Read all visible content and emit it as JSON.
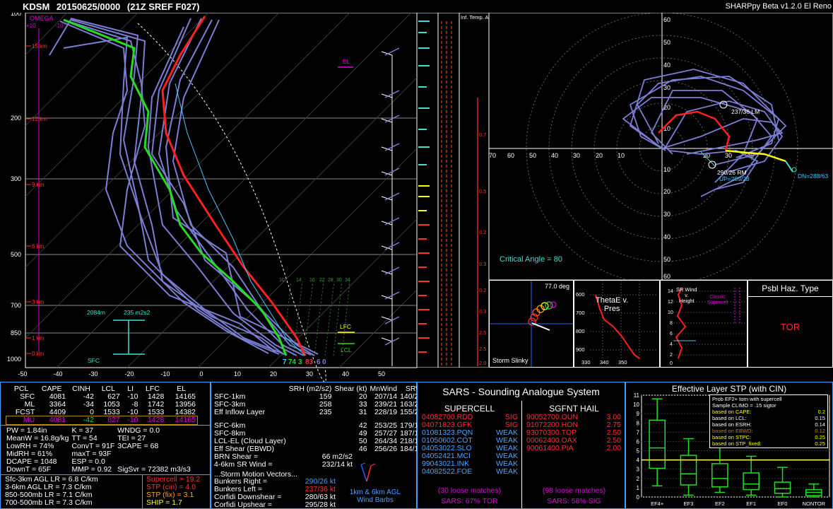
{
  "header": {
    "station": "KDSM",
    "datetime": "20150625/0000",
    "model_info": "(21Z  SREF  F027)",
    "app_name": "SHARPpy Beta v1.2.0 El Reno"
  },
  "skewt": {
    "pressure_labels": [
      "100",
      "200",
      "300",
      "500",
      "700",
      "850",
      "1000"
    ],
    "temp_labels": [
      "-50",
      "-40",
      "-30",
      "-20",
      "-10",
      "0",
      "10",
      "20",
      "30",
      "40",
      "50"
    ],
    "height_labels": [
      "15 km",
      "12 km",
      "9 km",
      "6 km",
      "3 km",
      "1 km",
      "0 km"
    ],
    "omega_label": "OMEGA",
    "omega_ticks": [
      "+10",
      "-10"
    ],
    "el_label": "EL",
    "lfc_label": "LFC",
    "lcl_label": "LCL",
    "sfc_label": "SFC",
    "inflow_top": "2084m",
    "inflow_srh": "235 m2s2",
    "sfc_temp": "83",
    "sfc_dwpt": "74",
    "sfc_wetbulb": "7",
    "sfc_extra": "3",
    "sfc_right1": "6",
    "sfc_right2": "0",
    "mixing_ratio_labels": [
      "10",
      "14",
      "16",
      "22",
      "28",
      "30",
      "34"
    ]
  },
  "inferred_temp": {
    "title": "Inf. Temp. Adv. (C/hr)",
    "values": [
      "0.7",
      "0.5",
      "0.2",
      "0.3",
      "0.2",
      "0.3",
      "2.5",
      "2.5",
      "2.0"
    ]
  },
  "hodograph": {
    "y_labels": [
      "60",
      "50",
      "40",
      "30",
      "20",
      "10",
      "10",
      "20",
      "30",
      "40",
      "50",
      "60"
    ],
    "x_labels": [
      "70",
      "60",
      "50",
      "40",
      "30",
      "20",
      "10",
      "20",
      "30",
      "40"
    ],
    "lm_label": "237/36 LM",
    "rm_label": "290/26 RM",
    "up_label": "UP=209/28",
    "dn_label": "DN=288/63",
    "critical_angle": "Critical Angle = 80"
  },
  "storm_slinky": {
    "title": "Storm Slinky",
    "angle": "77.0 deg"
  },
  "thetae": {
    "title_line1": "ThetaE v.",
    "title_line2": "Pres",
    "y_labels": [
      "600",
      "700",
      "800",
      "900"
    ],
    "x_labels": [
      "330",
      "340",
      "350"
    ]
  },
  "srwind": {
    "title_line1": "SR Wind",
    "title_line2": "v.",
    "title_line3": "Height",
    "classic_line1": "Classic",
    "classic_line2": "Supercell",
    "y_labels": [
      "14",
      "12",
      "10",
      "8",
      "6",
      "4",
      "2",
      "0"
    ]
  },
  "hazard": {
    "title": "Psbl Haz. Type",
    "value": "TOR"
  },
  "thermo": {
    "headers": [
      "PCL",
      "CAPE",
      "CINH",
      "LCL",
      "LI",
      "LFC",
      "EL"
    ],
    "rows": [
      [
        "SFC",
        "4081",
        "-42",
        "627",
        "-10",
        "1428",
        "14165"
      ],
      [
        "ML",
        "3364",
        "-34",
        "1053",
        "-8",
        "1742",
        "13956"
      ],
      [
        "FCST",
        "4409",
        "0",
        "1533",
        "-10",
        "1533",
        "14382"
      ],
      [
        "MU",
        "4081",
        "-42",
        "627",
        "-10",
        "1428",
        "14165"
      ]
    ],
    "indices": [
      [
        "PW = 1.84in",
        "K = 37",
        "WNDG = 0.0"
      ],
      [
        "MeanW = 16.8g/kg",
        "TT = 54",
        "TEI = 27"
      ],
      [
        "LowRH = 74%",
        "ConvT = 91F",
        "3CAPE = 68"
      ],
      [
        "MidRH = 61%",
        "maxT = 93F",
        ""
      ],
      [
        "DCAPE = 1048",
        "ESP = 0.0",
        ""
      ],
      [
        "DownT = 65F",
        "MMP = 0.92",
        "SigSvr = 72382 m3/s3"
      ]
    ],
    "lapse_rates": [
      "Sfc-3km AGL LR = 6.8 C/km",
      "3-6km AGL LR = 7.3 C/km",
      "850-500mb LR = 7.1 C/km",
      "700-500mb LR = 7.3 C/km"
    ],
    "composites": [
      {
        "label": "Supercell = 19.2",
        "color": "#ff3030"
      },
      {
        "label": "STP (cin) = 4.0",
        "color": "#ff3030"
      },
      {
        "label": "STP (fix) = 3.1",
        "color": "#ffa500"
      },
      {
        "label": "SHIP = 1.7",
        "color": "#ffff00"
      }
    ]
  },
  "kinematics": {
    "headers": [
      "SRH (m2/s2)",
      "Shear (kt)",
      "MnWind",
      "SRW"
    ],
    "rows": [
      [
        "SFC-1km",
        "159",
        "20",
        "207/14",
        "140/28"
      ],
      [
        "SFC-3km",
        "258",
        "33",
        "239/21",
        "163/21"
      ],
      [
        "Eff Inflow Layer",
        "235",
        "31",
        "228/19",
        "155/24"
      ],
      [
        "",
        "",
        "",
        "",
        ""
      ],
      [
        "SFC-6km",
        "",
        "42",
        "253/25",
        "179/16"
      ],
      [
        "SFC-8km",
        "",
        "49",
        "257/27",
        "187/15"
      ],
      [
        "LCL-EL (Cloud Layer)",
        "",
        "50",
        "264/34",
        "218/15"
      ],
      [
        "Eff Shear (EBWD)",
        "",
        "46",
        "256/26",
        "184/15"
      ]
    ],
    "brn": [
      [
        "BRN Shear =",
        "66 m2/s2"
      ],
      [
        "4-6km SR Wind =",
        "232/14 kt"
      ]
    ],
    "motion_title": "...Storm Motion Vectors...",
    "motions": [
      {
        "label": "Bunkers Right =",
        "value": "290/26 kt",
        "color": "#4d9dff"
      },
      {
        "label": "Bunkers Left =",
        "value": "237/36 kt",
        "color": "#ff3030"
      },
      {
        "label": "Corfidi Downshear =",
        "value": "280/63 kt",
        "color": "#ffffff"
      },
      {
        "label": "Corfidi Upshear =",
        "value": "295/28 kt",
        "color": "#ffffff"
      }
    ],
    "barb_label_line1": "1km & 6km AGL",
    "barb_label_line2": "Wind Barbs"
  },
  "sars": {
    "title": "SARS - Sounding Analogue System",
    "supercell_title": "SUPERCELL",
    "hail_title": "SGFNT HAIL",
    "supercell": [
      {
        "id": "04082700.RDD",
        "type": "SIG",
        "color": "#ff3030"
      },
      {
        "id": "04071823.GFK",
        "type": "SIG",
        "color": "#ff3030"
      },
      {
        "id": "01081323.PQN",
        "type": "WEAK",
        "color": "#4da6ff"
      },
      {
        "id": "01050602.COT",
        "type": "WEAK",
        "color": "#4da6ff"
      },
      {
        "id": "04053022.SLO",
        "type": "WEAK",
        "color": "#4da6ff"
      },
      {
        "id": "04052421.MCI",
        "type": "WEAK",
        "color": "#4da6ff"
      },
      {
        "id": "99043021.INK",
        "type": "WEAK",
        "color": "#4da6ff"
      },
      {
        "id": "04082522.FOE",
        "type": "WEAK",
        "color": "#4da6ff"
      }
    ],
    "hail": [
      {
        "id": "90052700.OUN",
        "size": "3.00"
      },
      {
        "id": "91072200.HON",
        "size": "2.75"
      },
      {
        "id": "93070300.TOP",
        "size": "2.50"
      },
      {
        "id": "00062400.OAX",
        "size": "2.50"
      },
      {
        "id": "90061400.PIA",
        "size": "2.00"
      }
    ],
    "supercell_matches": "(30 loose matches)",
    "supercell_prob": "SARS: 67% TOR",
    "hail_matches": "(98 loose matches)",
    "hail_prob": "SARS: 58% SIG"
  },
  "stp_box": {
    "title": "Effective Layer STP (with CIN)",
    "legend_title_line1": "Prob EF2+ torn with supercell",
    "legend_title_line2": "Sample CLIMO = .15 sigtor",
    "legend": [
      {
        "label": "based on CAPE:",
        "value": "0.2",
        "color": "#ffff00"
      },
      {
        "label": "based on LCL:",
        "value": "0.15",
        "color": "#ffffff"
      },
      {
        "label": "based on ESRH:",
        "value": "0.14",
        "color": "#ffffff"
      },
      {
        "label": "based on EBWD:",
        "value": "0.12",
        "color": "#b8860b"
      },
      {
        "label": "based on STPC:",
        "value": "0.25",
        "color": "#ffff00"
      },
      {
        "label": "based on STP_fixed:",
        "value": "0.25",
        "color": "#ffff00"
      }
    ],
    "y_labels": [
      "11",
      "10",
      "9",
      "8",
      "7",
      "6",
      "5",
      "4",
      "3",
      "2",
      "1",
      "0"
    ],
    "categories": [
      "EF4+",
      "EF3",
      "EF2",
      "EF1",
      "EF0",
      "NONTOR"
    ],
    "stp_value": 4.0
  }
}
